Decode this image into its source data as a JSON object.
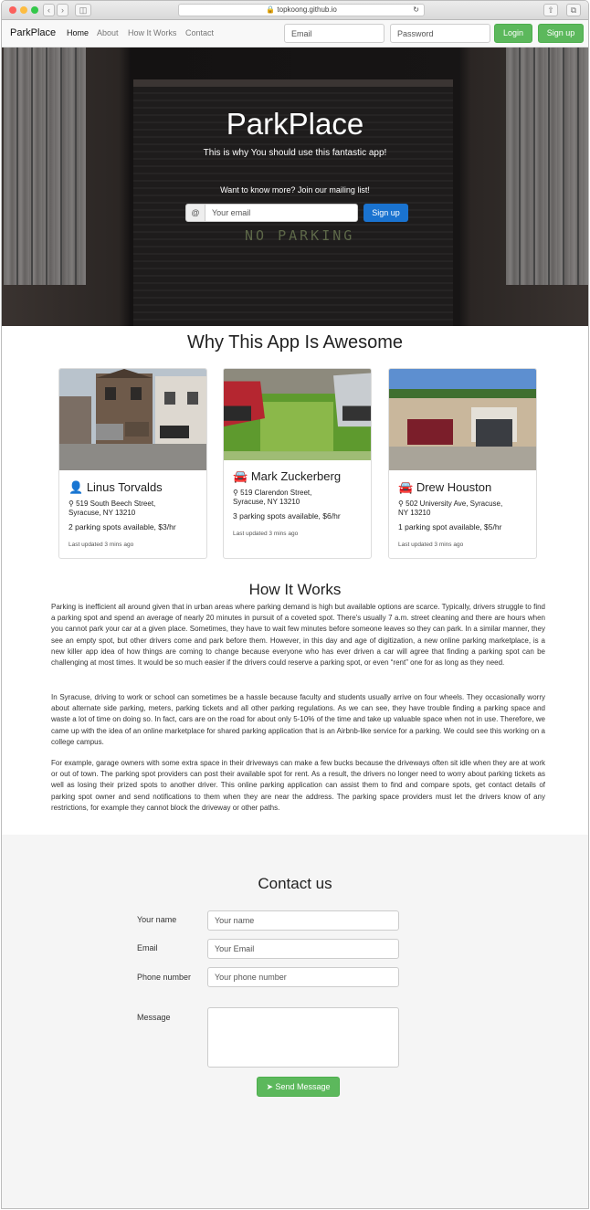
{
  "browser": {
    "url": "topkoong.github.io"
  },
  "nav": {
    "brand": "ParkPlace",
    "links": [
      "Home",
      "About",
      "How It Works",
      "Contact"
    ],
    "email_placeholder": "Email",
    "password_placeholder": "Password",
    "login": "Login",
    "signup": "Sign up"
  },
  "hero": {
    "title": "ParkPlace",
    "subtitle": "This is why You should use this fantastic app!",
    "mailing_text": "Want to know more? Join our mailing list!",
    "addon": "@",
    "email_placeholder": "Your email",
    "signup": "Sign up",
    "sign_text": "NO PARKING"
  },
  "why": {
    "title": "Why This App Is Awesome",
    "cards": [
      {
        "name": "Linus Torvalds",
        "icon": "user-icon",
        "address1": "519 South Beech Street,",
        "address2": "Syracuse, NY 13210",
        "spots": "2 parking spots available, $3/hr",
        "updated": "Last updated 3 mins ago"
      },
      {
        "name": "Mark Zuckerberg",
        "icon": "car-icon",
        "address1": "519 Clarendon Street,",
        "address2": "Syracuse, NY 13210",
        "spots": "3 parking spots available, $6/hr",
        "updated": "Last updated 3 mins ago"
      },
      {
        "name": "Drew Houston",
        "icon": "car-icon",
        "address1": "502 University Ave, Syracuse,",
        "address2": "NY 13210",
        "spots": "1 parking spot available, $5/hr",
        "updated": "Last updated 3 mins ago"
      }
    ]
  },
  "how": {
    "title": "How It Works",
    "paragraphs": [
      "Parking is inefficient all around given that in urban areas where parking demand is high but available options are scarce. Typically, drivers struggle to find a parking spot and spend an average of nearly 20 minutes in pursuit of a coveted spot. There's usually 7 a.m. street cleaning and there are hours when you cannot park your car at a given place. Sometimes, they have to wait few minutes before someone leaves so they can park. In a similar manner, they see an empty spot, but other drivers come and park before them. However, in this day and age of digitization, a new online parking marketplace, is a new killer app idea of how things are coming to change because everyone who has ever driven a car will agree that finding a parking spot can be challenging at most times. It would be so much easier if the drivers could reserve a parking spot, or even “rent” one for as long as they need.",
      "In Syracuse, driving to work or school can sometimes be a hassle because faculty and students usually arrive on four wheels. They occasionally worry about alternate side parking, meters, parking tickets and all other parking regulations. As we can see, they have trouble finding a parking space and waste a lot of time on doing so. In fact, cars are on the road for about only 5-10% of the time and take up valuable space when not in use. Therefore, we came up with the idea of an online marketplace for shared parking application that is an Airbnb-like service for a parking. We could see this working on a college campus.",
      "For example, garage owners with some extra space in their driveways can make a few bucks because the driveways often sit idle when they are at work or out of town. The parking spot providers can post their available spot for rent. As a result, the drivers no longer need to worry about parking tickets as well as losing their prized spots to another driver. This online parking application can assist them to find and compare spots, get contact details of parking spot owner and send notifications to them when they are near the address. The parking space providers must let the drivers know of any restrictions, for example they cannot block the driveway or other paths."
    ]
  },
  "contact": {
    "title": "Contact us",
    "name_label": "Your name",
    "name_placeholder": "Your name",
    "email_label": "Email",
    "email_placeholder": "Your Email",
    "phone_label": "Phone number",
    "phone_placeholder": "Your phone number",
    "message_label": "Message",
    "send": "Send Message"
  }
}
